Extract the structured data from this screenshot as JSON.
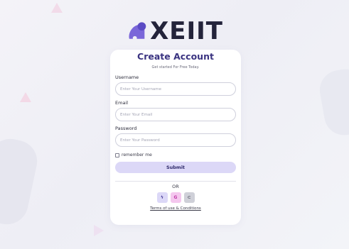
{
  "brand": {
    "name": "XEIIT"
  },
  "form": {
    "title": "Create Account",
    "subtitle": "Get started For Free Today.",
    "username": {
      "label": "Username",
      "placeholder": "Enter Your Username",
      "value": ""
    },
    "email": {
      "label": "Email",
      "placeholder": "Enter Your Email",
      "value": ""
    },
    "password": {
      "label": "Password",
      "placeholder": "Enter Your Password",
      "value": ""
    },
    "remember": {
      "label": "remember me",
      "checked": false
    },
    "submit_label": "Submit",
    "divider_text": "OR",
    "social": [
      {
        "icon": "lightning-icon",
        "glyph": "ϟ",
        "color": "#dcd8f7"
      },
      {
        "icon": "google-icon",
        "glyph": "G",
        "color": "#f4c7ee"
      },
      {
        "icon": "link-icon",
        "glyph": "⊂",
        "color": "#cfd0d8"
      }
    ],
    "terms_link": "Terms of use & Conditions"
  },
  "colors": {
    "accent": "#3b3481",
    "button": "#dcd8f7",
    "background": "#f1f1f6"
  }
}
